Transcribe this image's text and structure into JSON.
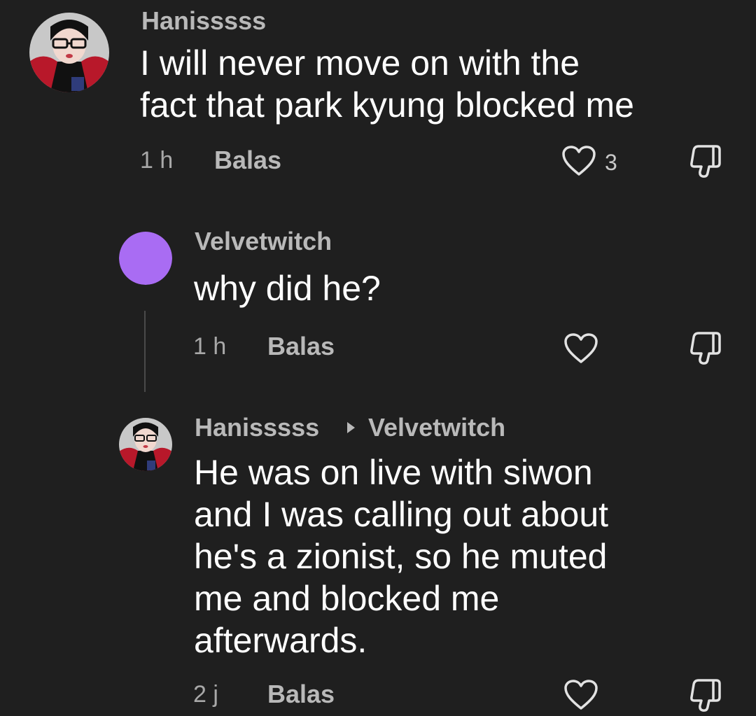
{
  "comments": [
    {
      "username": "Hanisssss",
      "text": "I will never move on with the\nfact that park kyung blocked me",
      "time": "1 h",
      "reply_label": "Balas",
      "like_count": "3"
    },
    {
      "username": "Velvetwitch",
      "text": "why did he?",
      "time": "1 h",
      "reply_label": "Balas",
      "avatar_color": "#a96cf3"
    },
    {
      "username": "Hanisssss",
      "reply_to": "Velvetwitch",
      "text": "He was on live with siwon\nand I was calling out about\nhe's a zionist, so he muted\nme and blocked me\nafterwards.",
      "time": "2 j",
      "reply_label": "Balas"
    }
  ],
  "theme": {
    "background": "#1f1f1f",
    "text": "#ffffff",
    "muted": "#b9b9b9"
  }
}
